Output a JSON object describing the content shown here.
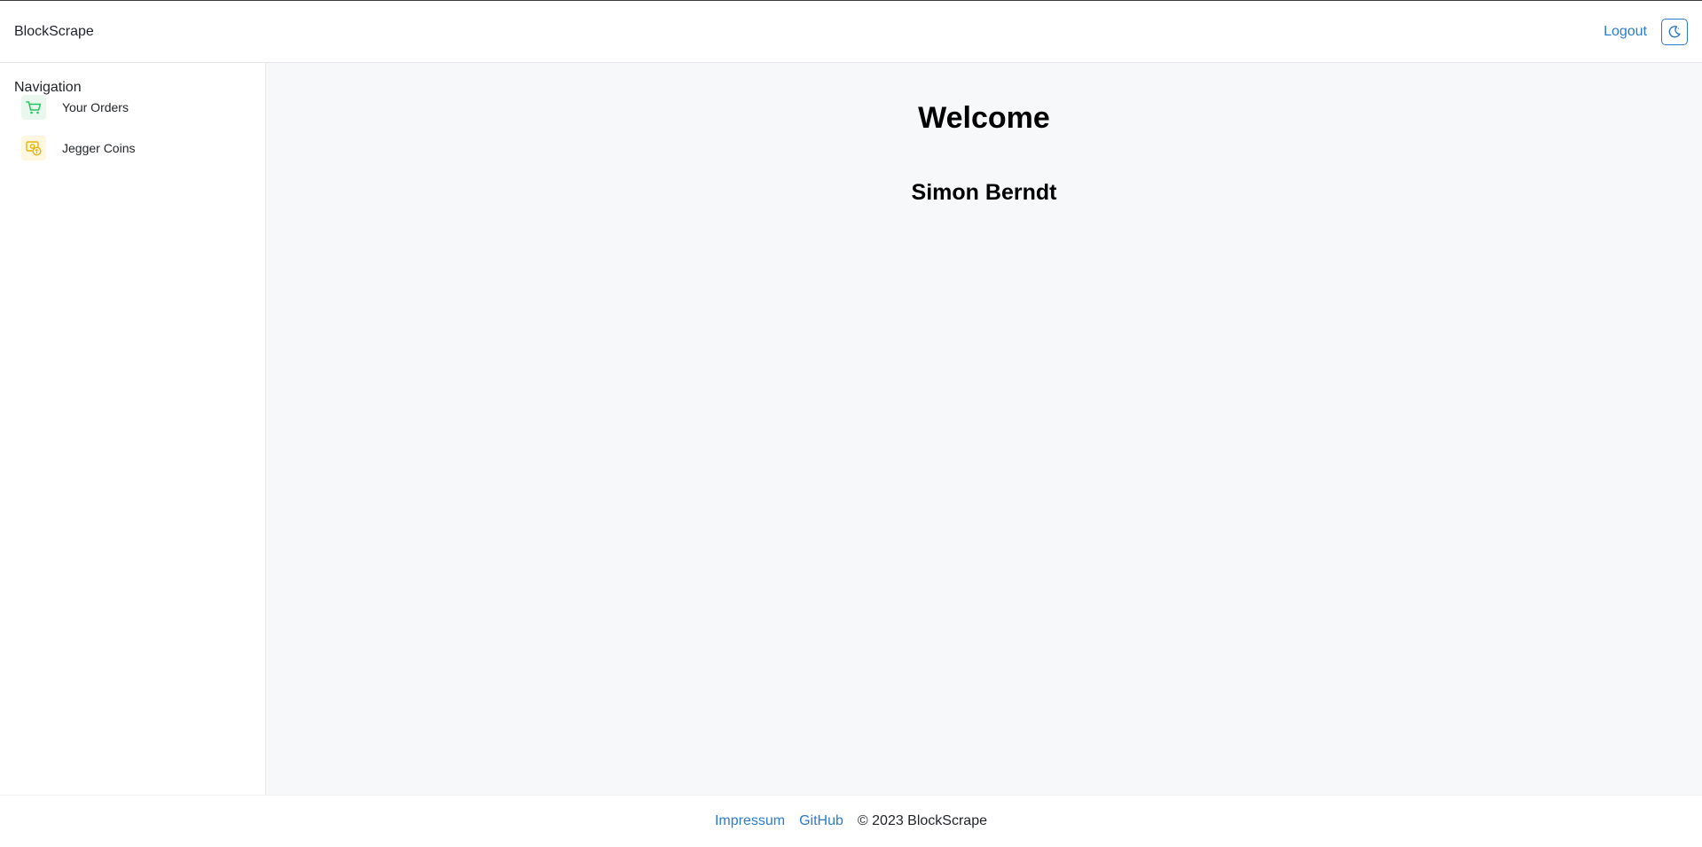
{
  "header": {
    "brand": "BlockScrape",
    "logout_label": "Logout",
    "theme_icon": "moon-icon"
  },
  "sidebar": {
    "title": "Navigation",
    "items": [
      {
        "label": "Your Orders",
        "icon": "cart-icon",
        "color": "#22c55e"
      },
      {
        "label": "Jegger Coins",
        "icon": "coins-icon",
        "color": "#eab308"
      }
    ]
  },
  "main": {
    "heading": "Welcome",
    "username": "Simon Berndt"
  },
  "footer": {
    "links": [
      "Impressum",
      "GitHub"
    ],
    "copyright": "© 2023 BlockScrape"
  },
  "colors": {
    "accent": "#2b7bd0",
    "main_bg": "#f7f8fa"
  }
}
